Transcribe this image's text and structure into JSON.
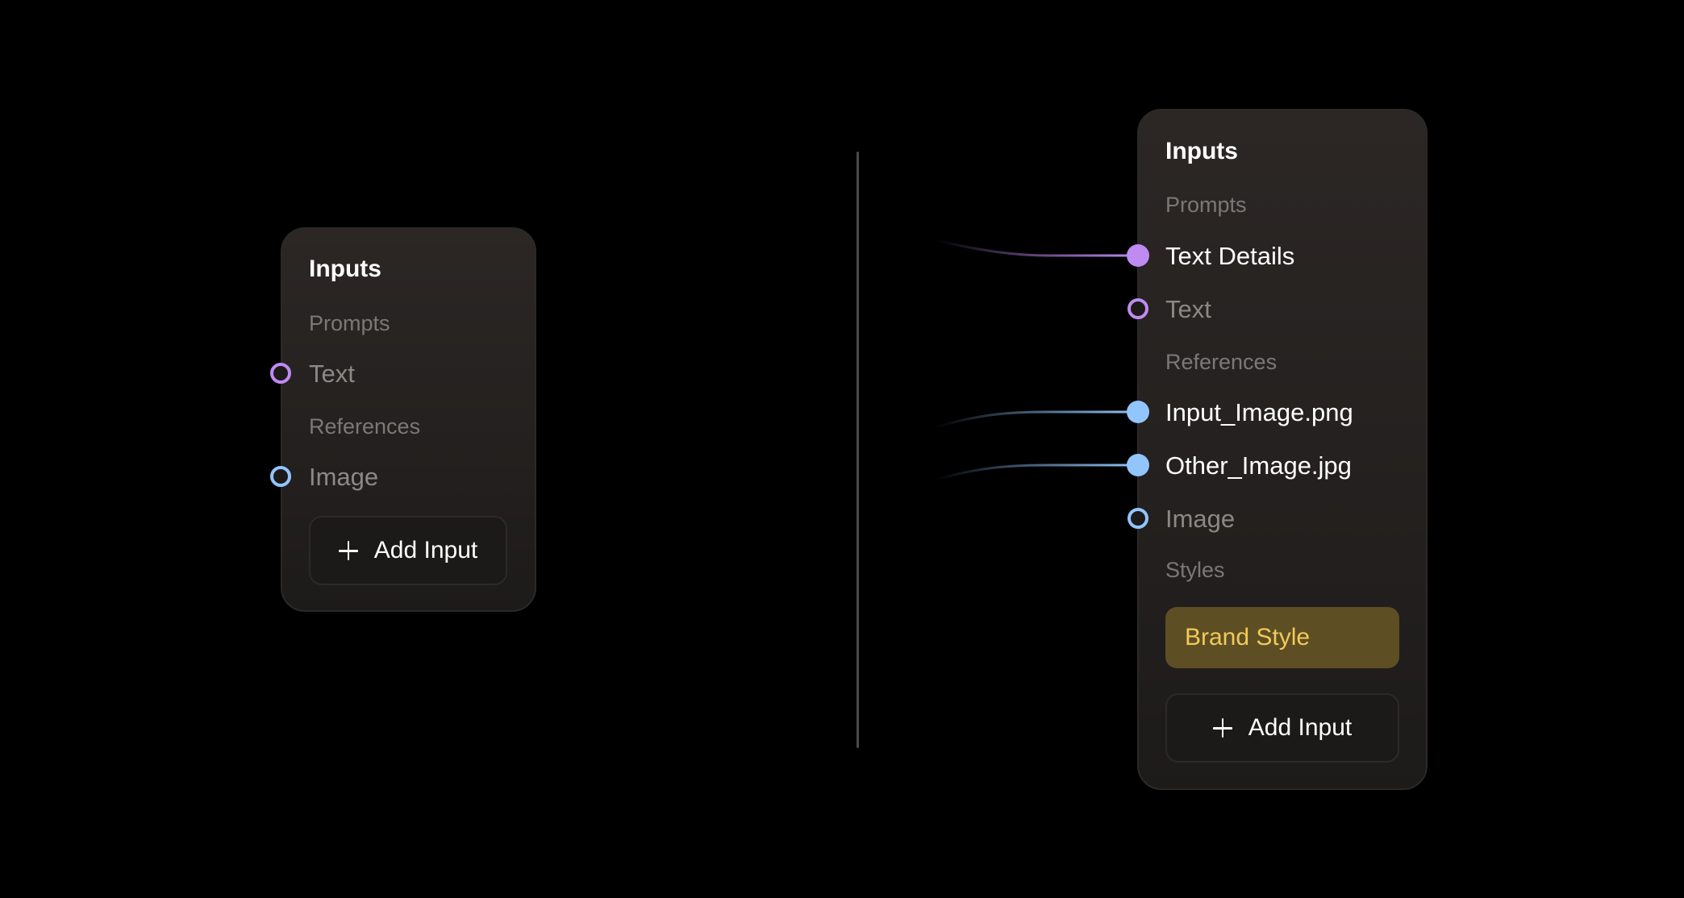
{
  "left_panel": {
    "title": "Inputs",
    "sections": {
      "prompts": "Prompts",
      "references": "References"
    },
    "items": {
      "text": "Text",
      "image": "Image"
    },
    "add_button": "Add Input"
  },
  "right_panel": {
    "title": "Inputs",
    "sections": {
      "prompts": "Prompts",
      "references": "References",
      "styles": "Styles"
    },
    "items": {
      "text_details": "Text Details",
      "text": "Text",
      "input_image": "Input_Image.png",
      "other_image": "Other_Image.jpg",
      "image": "Image"
    },
    "brand_style": "Brand Style",
    "add_button": "Add Input"
  },
  "icons": {
    "add": "plus-icon",
    "text_port": "circle-port-icon",
    "image_port": "circle-port-icon"
  },
  "colors": {
    "background": "#000000",
    "panel": "#252220",
    "text_port": "#c08af3",
    "image_port": "#92c5fb",
    "brand_chip_bg": "#5d4e24",
    "brand_chip_text": "#f2ca59"
  }
}
